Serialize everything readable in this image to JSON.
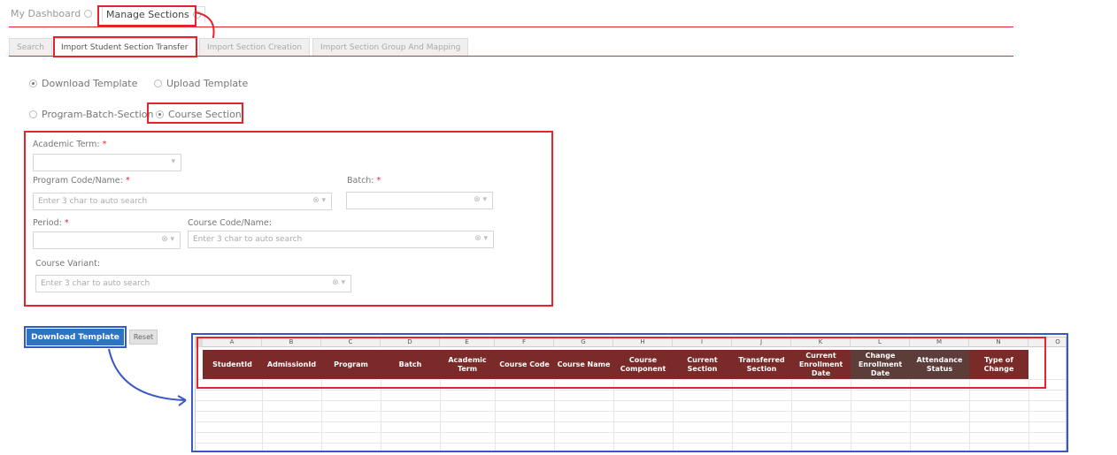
{
  "tabs": {
    "dashboard": "My Dashboard",
    "manage": "Manage Sections"
  },
  "subtabs": [
    {
      "label": "Search"
    },
    {
      "label": "Import Student Section Transfer"
    },
    {
      "label": "Import Section Creation"
    },
    {
      "label": "Import Section Group And Mapping"
    }
  ],
  "mode": {
    "download": "Download Template",
    "upload": "Upload Template",
    "selected": "Download Template"
  },
  "type": {
    "program": "Program-Batch-Section",
    "course": "Course Section",
    "selected": "Course Section"
  },
  "form": {
    "academic_term": "Academic Term:",
    "program": "Program Code/Name:",
    "program_placeholder": "Enter 3 char to auto search",
    "batch": "Batch:",
    "period": "Period:",
    "course": "Course Code/Name:",
    "course_placeholder": "Enter 3 char to auto search",
    "variant": "Course Variant:",
    "variant_placeholder": "Enter 3 char to auto search",
    "required_mark": "*"
  },
  "buttons": {
    "download": "Download Template",
    "reset": "Reset"
  },
  "sheet": {
    "columns": [
      "A",
      "B",
      "C",
      "D",
      "E",
      "F",
      "G",
      "H",
      "I",
      "J",
      "K",
      "L",
      "M",
      "N",
      "O"
    ],
    "headers": [
      "StudentId",
      "AdmissionId",
      "Program",
      "Batch",
      "Academic Term",
      "Course Code",
      "Course Name",
      "Course Component",
      "Current Section",
      "Transferred Section",
      "Current Enrollment Date",
      "Change Enrollment Date",
      "Attendance Status",
      "Type of Change"
    ]
  },
  "colors": {
    "annotation_red": "#e4232b",
    "annotation_blue": "#3a57c8",
    "header_maroon": "#7a2a28",
    "button_blue": "#2e74c3"
  }
}
